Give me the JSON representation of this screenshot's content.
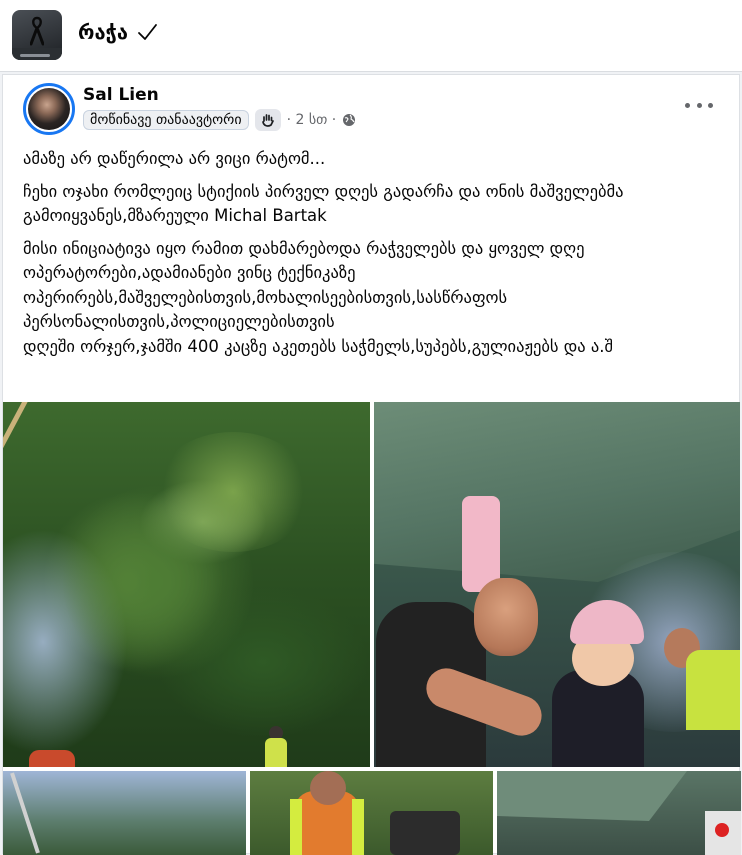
{
  "group": {
    "name": "რაჭა",
    "verified_icon": "check-icon",
    "avatar_icon": "mourning-ribbon-icon"
  },
  "post": {
    "author": "Sal Lien",
    "badge": "მოწინავე თანაავტორი",
    "badge_icon": "waving-hand-icon",
    "time": "· 2 სთ ·",
    "privacy_icon": "globe-icon",
    "more_icon": "more-options-icon",
    "paragraphs": [
      "ამაზე არ დაწერილა არ ვიცი რატომ...",
      "ჩეხი ოჯახი რომლეიც სტიქიის პირველ დღეს გადარჩა და ონის მაშველებმა გამოიყვანეს,მზარეული Michal Bartak",
      "მისი ინიციატივა იყო რამით დახმარებოდა რაჭველებს და ყოველ დღე ოპერატორები,ადამიანები ვინც ტექნიკაზე\nოპერირებს,მაშველებისთვის,მოხალისეებისთვის,სასწრაფოს პერსონალისთვის,პოლიციელებისთვის\nდღეში ორჯერ,ჯამში 400 კაცზე აკეთებს საჭმელს,სუპებს,გულიაჟებს და ა.შ"
    ]
  },
  "colors": {
    "accent": "#1877f2",
    "background": "#f0f2f5",
    "card": "#ffffff",
    "secondary_text": "#65676b"
  }
}
